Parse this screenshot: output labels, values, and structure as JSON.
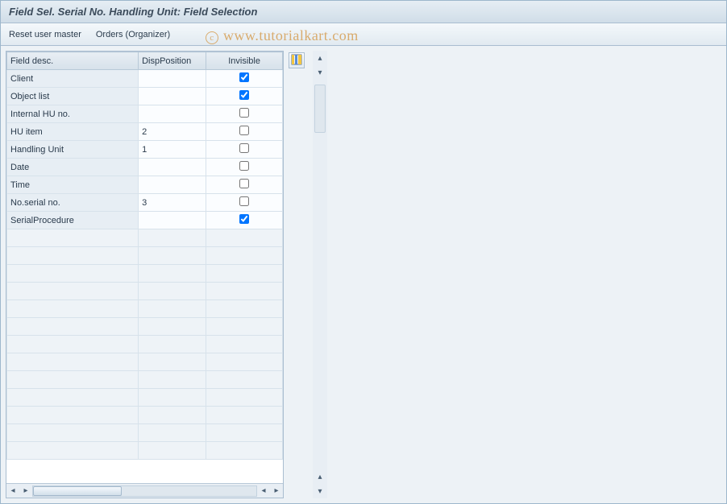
{
  "title": "Field Sel. Serial No. Handling Unit: Field Selection",
  "toolbar": {
    "reset_user_master": "Reset user master",
    "orders_organizer": "Orders (Organizer)"
  },
  "watermark": "www.tutorialkart.com",
  "table": {
    "headers": {
      "field_desc": "Field desc.",
      "disp_position": "DispPosition",
      "invisible": "Invisible"
    },
    "rows": [
      {
        "desc": "Client",
        "disp": "",
        "invisible": true
      },
      {
        "desc": "Object list",
        "disp": "",
        "invisible": true
      },
      {
        "desc": "Internal HU no.",
        "disp": "",
        "invisible": false
      },
      {
        "desc": "HU item",
        "disp": "2",
        "invisible": false
      },
      {
        "desc": "Handling Unit",
        "disp": "1",
        "invisible": false
      },
      {
        "desc": "Date",
        "disp": "",
        "invisible": false
      },
      {
        "desc": "Time",
        "disp": "",
        "invisible": false
      },
      {
        "desc": "No.serial no.",
        "disp": "3",
        "invisible": false
      },
      {
        "desc": "SerialProcedure",
        "disp": "",
        "invisible": true
      }
    ],
    "empty_rows": 13
  },
  "icons": {
    "table_settings": "table-columns-icon"
  }
}
